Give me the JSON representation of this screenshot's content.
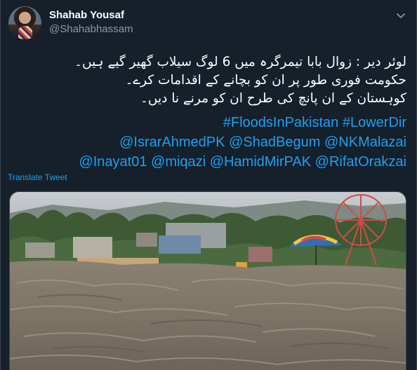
{
  "user": {
    "name": "Shahab Yousaf",
    "handle": "@Shahabhassam"
  },
  "tweet": {
    "lines": [
      "لوئر دیر : زوال بابا تیمرگرہ میں 6 لوگ سیلاب گھیر گیے ہیں۔",
      "حکومت فوری طور پر ان کو بچانے کے اقدامات کرے۔",
      "کوہستان کے ان پانچ کی طرح ان کو مرنے نا دیں۔"
    ],
    "hashtags": [
      "#FloodsInPakistan",
      "#LowerDir"
    ],
    "mentions_row1": [
      "@IsrarAhmedPK",
      "@ShadBegum",
      "@NKMalazai"
    ],
    "mentions_row2": [
      "@Inayat01",
      "@miqazi",
      "@HamidMirPAK",
      "@RifatOrakzai"
    ],
    "translate_label": "Translate Tweet"
  },
  "icons": {
    "more": "chevron-down-icon"
  },
  "colors": {
    "background": "#15202b",
    "link": "#1da1f2",
    "secondary_text": "#8899a6"
  }
}
